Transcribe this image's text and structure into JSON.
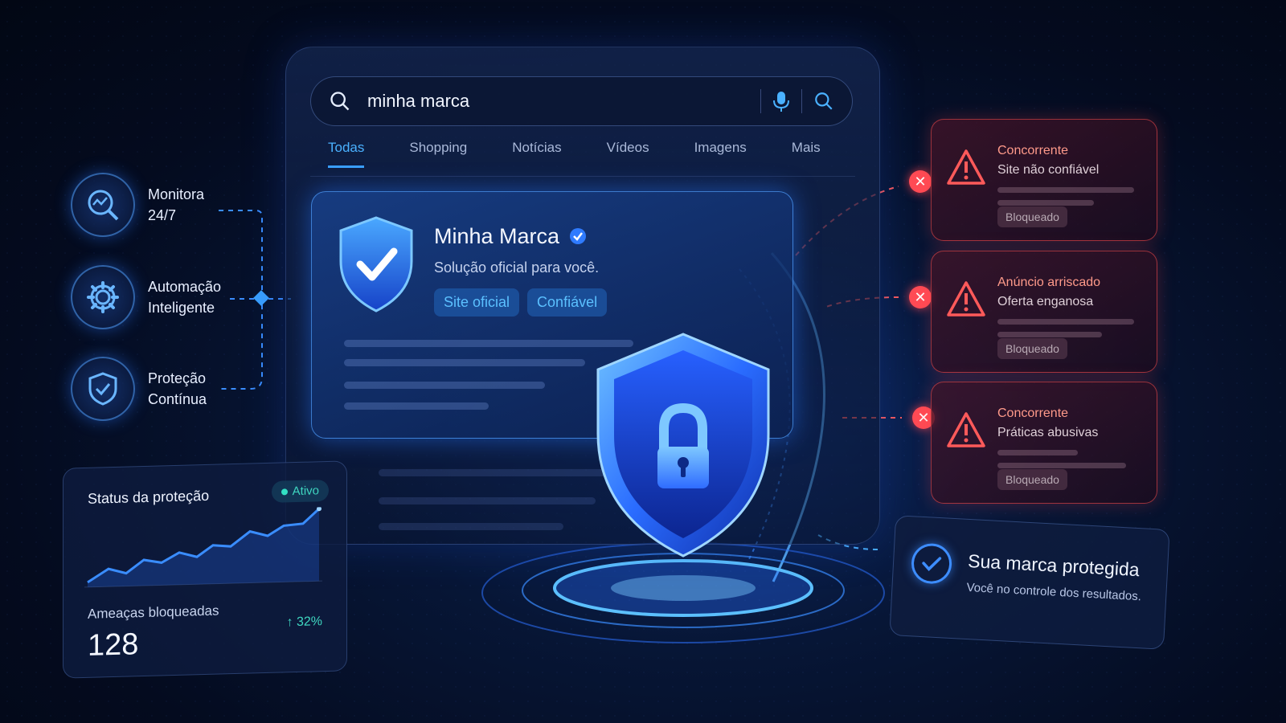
{
  "search": {
    "query": "minha marca"
  },
  "tabs": [
    "Todas",
    "Shopping",
    "Notícias",
    "Vídeos",
    "Imagens",
    "Mais"
  ],
  "result": {
    "title": "Minha Marca",
    "description": "Solução oficial para você.",
    "badges": [
      "Site oficial",
      "Confiável"
    ]
  },
  "features": [
    {
      "label": "Monitora\n24/7",
      "icon": "search-chart-icon"
    },
    {
      "label": "Automação\nInteligente",
      "icon": "gear-icon"
    },
    {
      "label": "Proteção\nContínua",
      "icon": "shield-check-icon"
    }
  ],
  "status": {
    "title": "Status da proteção",
    "state": "Ativo",
    "threats_label": "Ameaças bloqueadas",
    "threats_count": "128",
    "change": "↑ 32%"
  },
  "threats": [
    {
      "title": "Concorrente",
      "subtitle": "Site não confiável",
      "status": "Bloqueado"
    },
    {
      "title": "Anúncio arriscado",
      "subtitle": "Oferta enganosa",
      "status": "Bloqueado"
    },
    {
      "title": "Concorrente",
      "subtitle": "Práticas abusivas",
      "status": "Bloqueado"
    }
  ],
  "protected": {
    "title": "Sua marca protegida",
    "subtitle": "Você no controle dos resultados."
  },
  "colors": {
    "accent": "#3aa0ff",
    "danger": "#ff4b55",
    "success": "#33e0c4",
    "background": "#040b1f"
  }
}
